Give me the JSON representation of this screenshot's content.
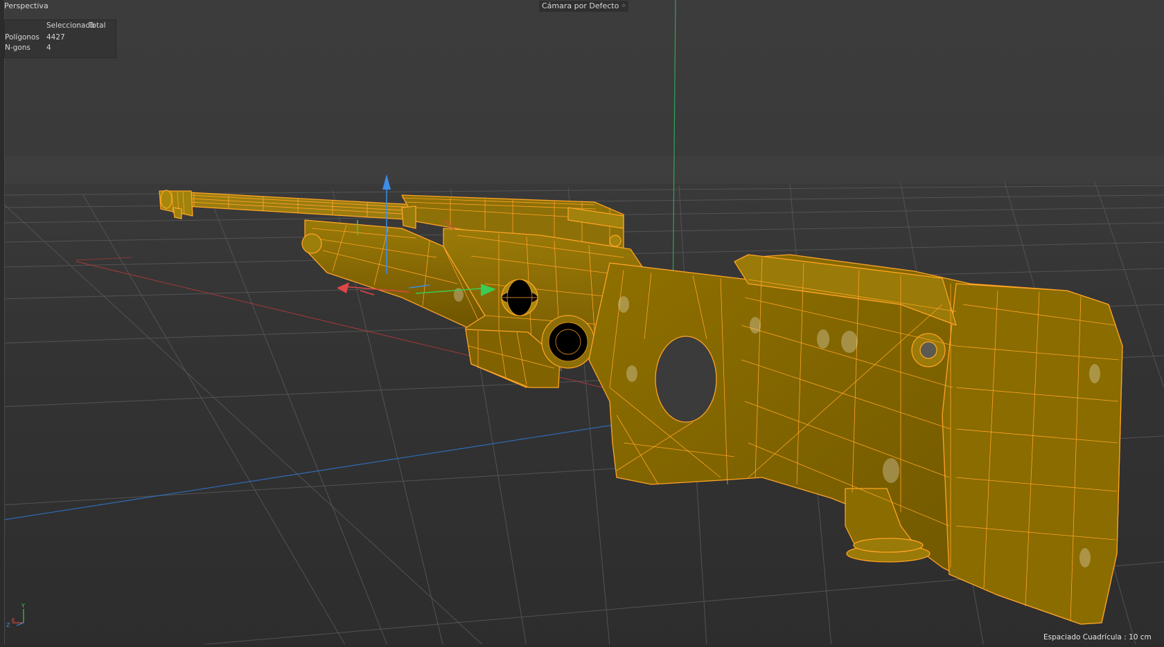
{
  "viewport": {
    "view_name": "Perspectiva",
    "camera_label": "Cámara por Defecto",
    "camera_icon": "camera-dots-icon"
  },
  "hud": {
    "headers": [
      "Seleccionado",
      "Total"
    ],
    "rows": [
      {
        "label": "Polígonos",
        "value": "4427"
      },
      {
        "label": "N-gons",
        "value": "4"
      }
    ]
  },
  "status": {
    "grid_spacing": "Espaciado Cuadrícula : 10 cm"
  },
  "axis_indicator": {
    "y": "Y",
    "x": "X",
    "z": "Z"
  },
  "colors": {
    "background": "#3a3a3a",
    "grid_line": "#5a5a5a",
    "wireframe": "#ffa020",
    "mesh_fill": "#8a6a00",
    "axis_x": "#d23c3c",
    "axis_y": "#3cc83c",
    "axis_z": "#2f7ad9"
  }
}
